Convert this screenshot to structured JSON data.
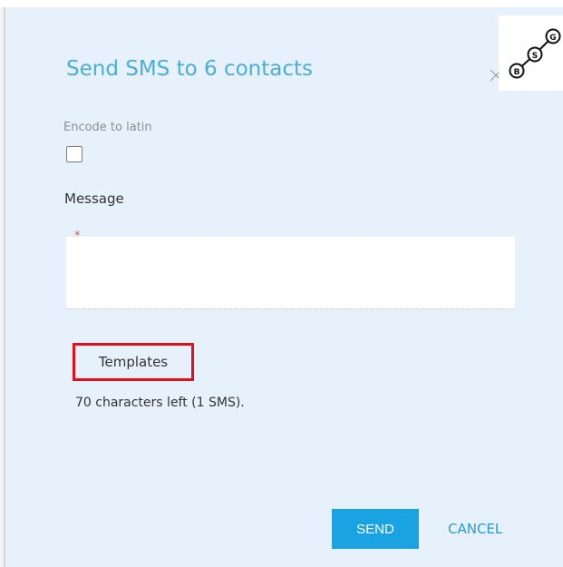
{
  "dialog": {
    "title": "Send SMS to 6 contacts",
    "encode_label": "Encode to latin",
    "encode_checked": false,
    "message_label": "Message",
    "message_required_marker": "*",
    "message_value": "",
    "templates_label": "Templates",
    "char_count_text": "70 characters left (1 SMS).",
    "send_label": "SEND",
    "cancel_label": "CANCEL",
    "close_icon": "close-icon"
  },
  "logo": {
    "letters": [
      "B",
      "S",
      "G"
    ]
  },
  "colors": {
    "dialog_bg": "#e6f1fb",
    "title": "#4aaed9",
    "send_button": "#1aa3e3",
    "cancel_link": "#2a9ad6",
    "highlight": "#e3101b",
    "required": "#e85a5a"
  }
}
